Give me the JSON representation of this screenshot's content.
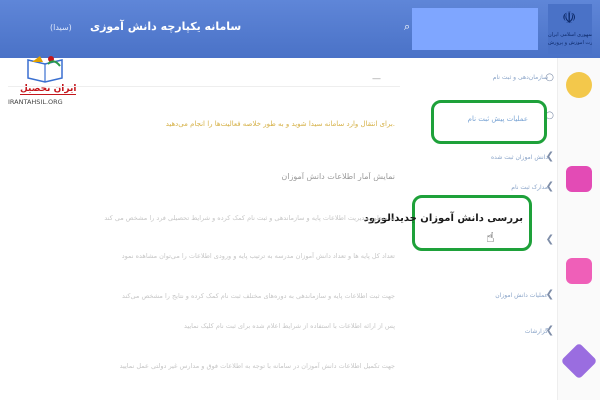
{
  "header": {
    "system_title": "سامانه یکپارچه دانش آموزی",
    "system_subtitle": "(سیدا)",
    "emblem_text_1": "جمهوری اسلامی ایران",
    "emblem_text_2": "وزارت آموزش و پرورش"
  },
  "logo": {
    "brand": "ایران تحصیل",
    "domain": "IRANTAHSIL.ORG"
  },
  "menu": {
    "items": [
      {
        "label": "سازمان‌دهی و ثبت نام"
      },
      {
        "label": "عملیات پیش ثبت نام"
      },
      {
        "label": "دانش آموزان ثبت شده"
      },
      {
        "label": "مدارک ثبت نام"
      },
      {
        "label": "بررسی دانش آموزان جدیدالورود"
      },
      {
        "label": "عملیات دانش آموزان"
      },
      {
        "label": "گزارشات"
      }
    ]
  },
  "content": {
    "warning": "برای انتقال وارد سامانه سیدا شوید و به طور خلاصه فعالیت‌ها را انجام می‌دهید.",
    "heading": "نمایش آمار اطلاعات دانش آموزان",
    "paragraphs": [
      "به منظور مدیریت اطلاعات پایه و سازماندهی و ثبت نام کمک کرده و شرایط تحصیلی فرد را مشخص می کند",
      "تعداد کل پایه ها و تعداد دانش آموزان مدرسه به ترتیب پایه و ورودی اطلاعات را می‌توان مشاهده نمود",
      "جهت ثبت اطلاعات پایه و سازماندهی به دوره‌های مختلف ثبت نام کمک کرده و نتایج را مشخص می‌کند",
      "پس از ارائه اطلاعات با استفاده از شرایط اعلام شده برای ثبت نام کلیک نمایید",
      "جهت تکمیل اطلاعات دانش آموزان در سامانه با توجه به اطلاعات فوق و مدارس غیر دولتی عمل نمایید"
    ]
  },
  "colors": {
    "header": "#4a72c7",
    "highlight": "#1ea13a",
    "brand": "#c4161c"
  }
}
